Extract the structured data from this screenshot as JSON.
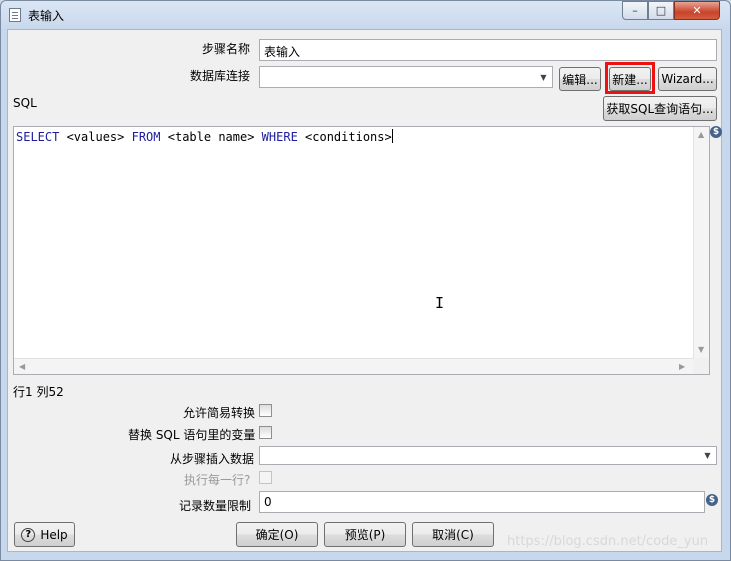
{
  "window": {
    "title": "表输入",
    "controls": {
      "minimize": "–",
      "maximize": "□",
      "close": "✕"
    }
  },
  "form": {
    "step_name_label": "步骤名称",
    "step_name_value": "表输入",
    "db_conn_label": "数据库连接",
    "db_conn_value": "",
    "edit_button": "编辑...",
    "new_button": "新建...",
    "wizard_button": "Wizard...",
    "sql_label": "SQL",
    "get_sql_button": "获取SQL查询语句...",
    "sql_text": {
      "kw_select": "SELECT",
      "t_values": " <values> ",
      "kw_from": "FROM",
      "t_table": " <table name> ",
      "kw_where": "WHERE",
      "t_conditions": " <conditions>"
    },
    "cursor_position": "行1 列52",
    "lazy_conversion_label": "允许简易转换",
    "replace_vars_label": "替换 SQL 语句里的变量",
    "insert_from_step_label": "从步骤插入数据",
    "insert_from_step_value": "",
    "execute_each_row_label": "执行每一行?",
    "limit_label": "记录数量限制",
    "limit_value": "0"
  },
  "buttons": {
    "help": "Help",
    "ok": "确定(O)",
    "preview": "预览(P)",
    "cancel": "取消(C)"
  },
  "icons": {
    "variable": "$",
    "help": "?"
  },
  "watermark": "https://blog.csdn.net/code_yun",
  "colors": {
    "highlight_border": "#ee1111",
    "sql_keyword": "#1d1d9c"
  }
}
